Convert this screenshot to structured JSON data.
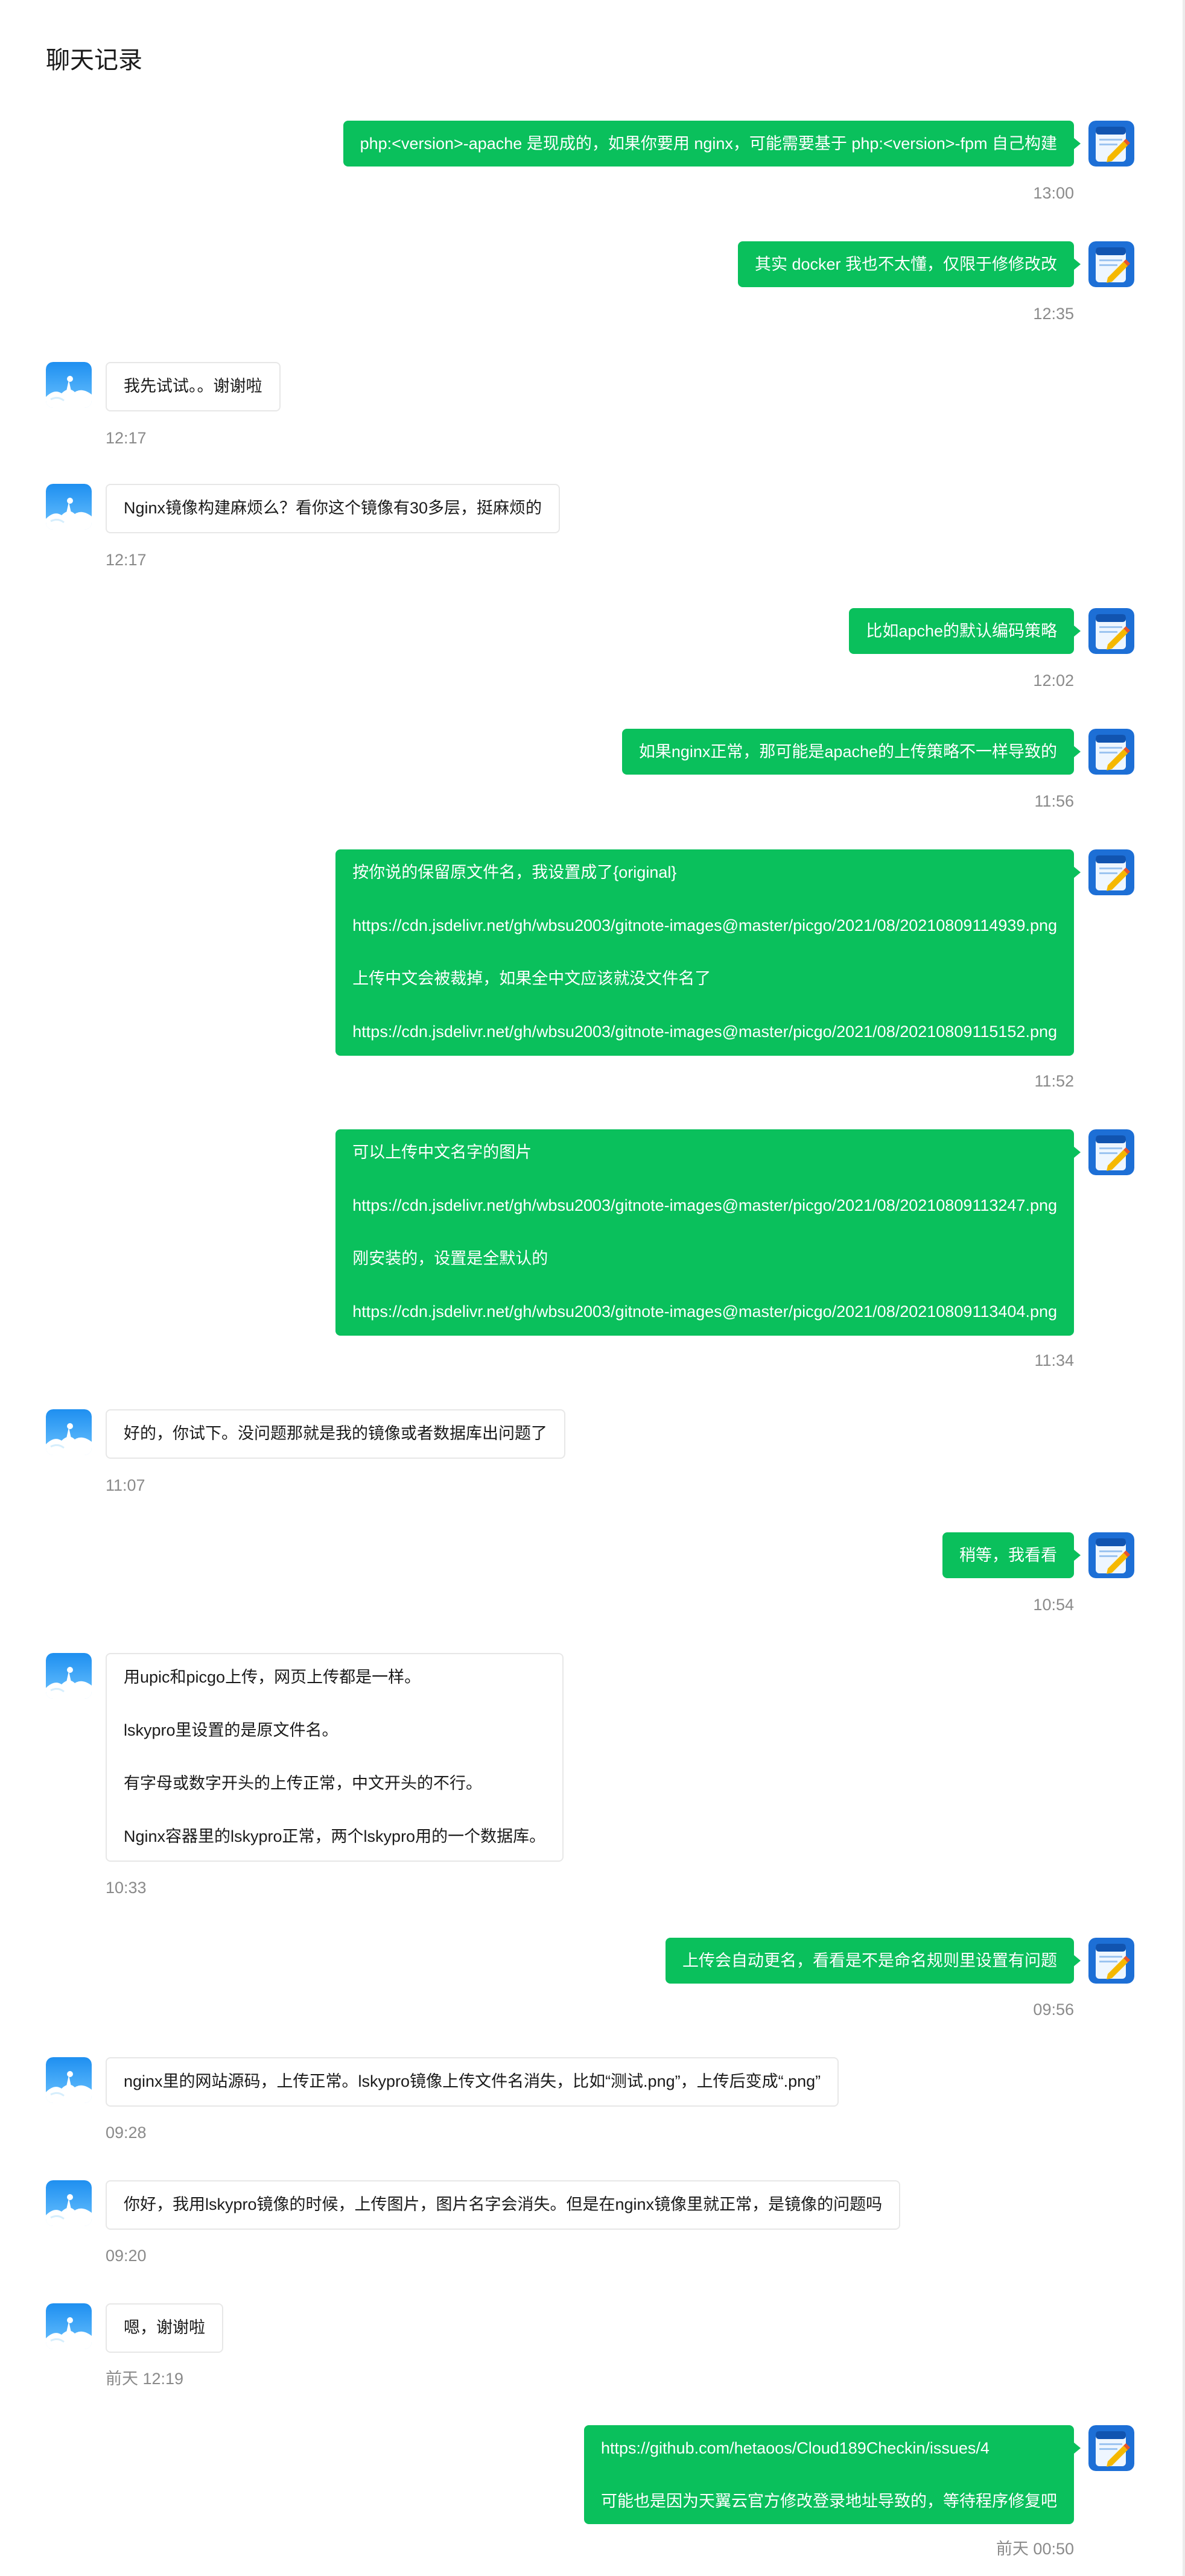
{
  "header": {
    "title": "聊天记录"
  },
  "colors": {
    "my_bubble": "#0ac05c",
    "their_bubble": "#ffffff",
    "timestamp": "#8a8a8a"
  },
  "avatars": {
    "mine": "notepad-app-icon",
    "theirs": "snowy-landscape-photo"
  },
  "messages": [
    {
      "sender": "me",
      "paragraphs": [
        "php:<version>-apache 是现成的，如果你要用 nginx，可能需要基于 php:<version>-fpm 自己构建"
      ],
      "time": "13:00"
    },
    {
      "sender": "me",
      "paragraphs": [
        "其实 docker 我也不太懂，仅限于修修改改"
      ],
      "time": "12:35"
    },
    {
      "sender": "other",
      "paragraphs": [
        "我先试试。。谢谢啦"
      ],
      "time": "12:17"
    },
    {
      "sender": "other",
      "paragraphs": [
        "Nginx镜像构建麻烦么？看你这个镜像有30多层，挺麻烦的"
      ],
      "time": "12:17"
    },
    {
      "sender": "me",
      "paragraphs": [
        "比如apche的默认编码策略"
      ],
      "time": "12:02"
    },
    {
      "sender": "me",
      "paragraphs": [
        "如果nginx正常，那可能是apache的上传策略不一样导致的"
      ],
      "time": "11:56"
    },
    {
      "sender": "me",
      "paragraphs": [
        "按你说的保留原文件名，我设置成了{original}",
        "https://cdn.jsdelivr.net/gh/wbsu2003/gitnote-images@master/picgo/2021/08/20210809114939.png",
        "上传中文会被裁掉，如果全中文应该就没文件名了",
        "https://cdn.jsdelivr.net/gh/wbsu2003/gitnote-images@master/picgo/2021/08/20210809115152.png"
      ],
      "time": "11:52"
    },
    {
      "sender": "me",
      "paragraphs": [
        "可以上传中文名字的图片",
        "https://cdn.jsdelivr.net/gh/wbsu2003/gitnote-images@master/picgo/2021/08/20210809113247.png",
        "刚安装的，设置是全默认的",
        "https://cdn.jsdelivr.net/gh/wbsu2003/gitnote-images@master/picgo/2021/08/20210809113404.png"
      ],
      "time": "11:34"
    },
    {
      "sender": "other",
      "paragraphs": [
        "好的，你试下。没问题那就是我的镜像或者数据库出问题了"
      ],
      "time": "11:07"
    },
    {
      "sender": "me",
      "paragraphs": [
        "稍等，我看看"
      ],
      "time": "10:54"
    },
    {
      "sender": "other",
      "paragraphs": [
        "用upic和picgo上传，网页上传都是一样。",
        "lskypro里设置的是原文件名。",
        "有字母或数字开头的上传正常，中文开头的不行。",
        "Nginx容器里的lskypro正常，两个lskypro用的一个数据库。"
      ],
      "time": "10:33"
    },
    {
      "sender": "me",
      "paragraphs": [
        "上传会自动更名，看看是不是命名规则里设置有问题"
      ],
      "time": "09:56"
    },
    {
      "sender": "other",
      "paragraphs": [
        "nginx里的网站源码，上传正常。lskypro镜像上传文件名消失，比如“测试.png”，上传后变成“.png”"
      ],
      "time": "09:28"
    },
    {
      "sender": "other",
      "paragraphs": [
        "你好，我用lskypro镜像的时候，上传图片，图片名字会消失。但是在nginx镜像里就正常，是镜像的问题吗"
      ],
      "time": "09:20"
    },
    {
      "sender": "other",
      "paragraphs": [
        "嗯，谢谢啦"
      ],
      "time": "前天 12:19"
    },
    {
      "sender": "me",
      "paragraphs": [
        "https://github.com/hetaoos/Cloud189Checkin/issues/4",
        "可能也是因为天翼云官方修改登录地址导致的，等待程序修复吧"
      ],
      "time": "前天 00:50"
    }
  ]
}
